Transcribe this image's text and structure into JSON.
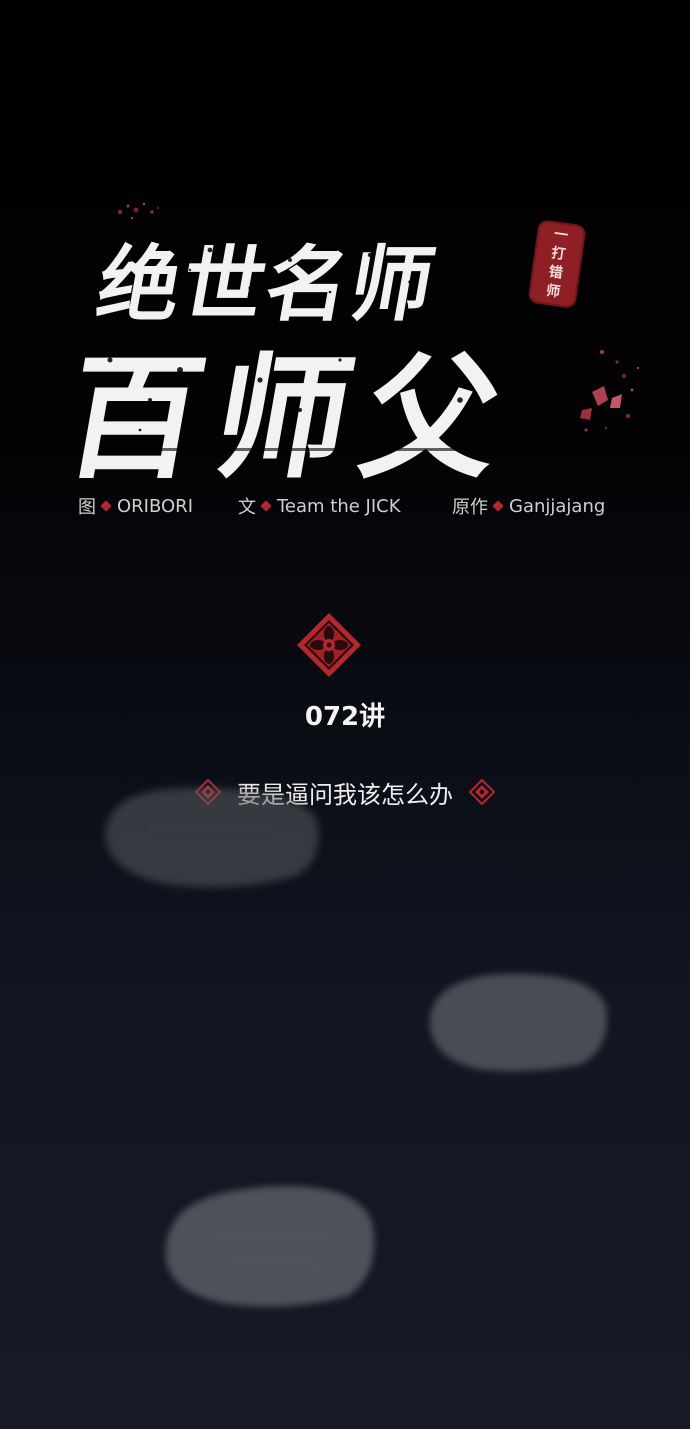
{
  "title": {
    "line1": "绝世名师",
    "line2": "百师父",
    "seal_text": [
      "一",
      "打",
      "错",
      "师"
    ]
  },
  "credits": [
    {
      "role": "图",
      "name": "ORIBORI"
    },
    {
      "role": "文",
      "name": "Team the JICK"
    },
    {
      "role": "原作",
      "name": "Ganjjajang"
    }
  ],
  "chapter": {
    "number": "072讲",
    "subtitle": "要是逼问我该怎么办"
  },
  "colors": {
    "accent_red": "#b4272e",
    "seal_red": "#8e1f24",
    "title_white": "#f2f2f2",
    "credit_gray": "#cfcfcf",
    "bubble_gray": "#8a8a8e"
  },
  "icons": {
    "emblem": "red-flower-emblem-icon",
    "ornament": "red-diamond-ornament-icon"
  }
}
